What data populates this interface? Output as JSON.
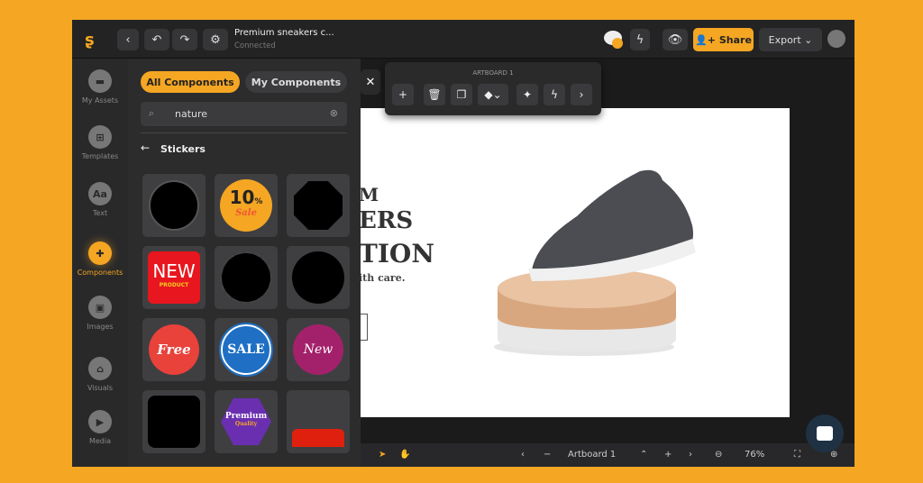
{
  "colors": {
    "accent": "#f5a623",
    "background": "#f5a623"
  },
  "header": {
    "title": "Premium sneakers c...",
    "status": "Connected",
    "share_label": "Share",
    "export_label": "Export"
  },
  "rail": {
    "items": [
      {
        "label": "My Assets"
      },
      {
        "label": "Templates"
      },
      {
        "label": "Text"
      },
      {
        "label": "Components"
      },
      {
        "label": "Images"
      },
      {
        "label": "Visuals"
      },
      {
        "label": "Media"
      }
    ]
  },
  "panel": {
    "tab_all": "All Components",
    "tab_my": "My Components",
    "search_value": "nature",
    "section": "Stickers",
    "stickers": [
      {
        "name": "black-circle"
      },
      {
        "name": "10-percent-sale",
        "text": "10",
        "sub": "Sale",
        "pct": "%"
      },
      {
        "name": "black-octagon-badge"
      },
      {
        "name": "new-product",
        "text": "NEW",
        "sub": "PRODUCT"
      },
      {
        "name": "black-starburst"
      },
      {
        "name": "black-circle-2"
      },
      {
        "name": "free",
        "text": "Free"
      },
      {
        "name": "sale",
        "text": "SALE"
      },
      {
        "name": "new-script",
        "text": "New"
      },
      {
        "name": "black-rounded-square"
      },
      {
        "name": "premium-quality",
        "text": "Premium",
        "sub": "Quality"
      },
      {
        "name": "red-splash"
      }
    ]
  },
  "toolbar": {
    "label": "ARTBOARD 1"
  },
  "artboard": {
    "line1": "M",
    "line2": "ERS",
    "line3": "TION",
    "line4": "ith care."
  },
  "bottom": {
    "artboard": "Artboard 1",
    "zoom": "76%"
  }
}
